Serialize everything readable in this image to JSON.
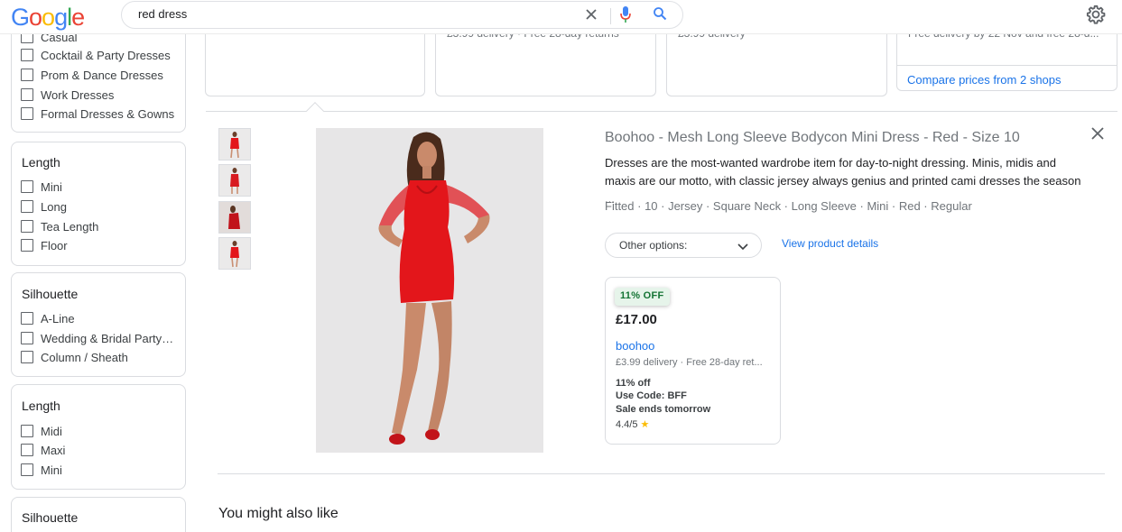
{
  "header": {
    "logo": [
      "G",
      "o",
      "o",
      "g",
      "l",
      "e"
    ],
    "logo_colors": [
      "#4285f4",
      "#ea4335",
      "#fbbc05",
      "#4285f4",
      "#34a853",
      "#ea4335"
    ],
    "search_value": "red dress",
    "icons": [
      "close-icon",
      "microphone-icon",
      "search-icon",
      "gear-icon"
    ]
  },
  "filters": [
    {
      "title": "",
      "options": [
        "Casual",
        "Cocktail & Party Dresses",
        "Prom & Dance Dresses",
        "Work Dresses",
        "Formal Dresses & Gowns"
      ]
    },
    {
      "title": "Length",
      "options": [
        "Mini",
        "Long",
        "Tea Length",
        "Floor"
      ]
    },
    {
      "title": "Silhouette",
      "options": [
        "A-Line",
        "Wedding & Bridal Party Dresses",
        "Column / Sheath"
      ]
    },
    {
      "title": "Length",
      "options": [
        "Midi",
        "Maxi",
        "Mini"
      ]
    },
    {
      "title": "Silhouette",
      "options": []
    }
  ],
  "top_cards": [
    {
      "text": "· · · · · · · · · · · · ·"
    },
    {
      "text": "£3.99 delivery · Free 28-day returns"
    },
    {
      "text": "£3.99 delivery"
    },
    {
      "text": "Free delivery by 22 Nov and free 28-d...",
      "compare": "Compare prices from 2 shops"
    }
  ],
  "product": {
    "title": "Boohoo - Mesh Long Sleeve Bodycon Mini Dress - Red - Size 10",
    "description": "Dresses are the most-wanted wardrobe item for day-to-night dressing. Minis, midis and maxis are our motto, with classic jersey always genius and printed cami dresses the season ...",
    "tags": "Fitted · 10 · Jersey · Square Neck · Long Sleeve · Mini · Red · Regular",
    "other_options": "Other options:",
    "view_details": "View product details",
    "offer": {
      "badge": "11% OFF",
      "price": "£17.00",
      "store": "boohoo",
      "delivery": "£3.99 delivery · Free 28-day ret...",
      "promo_1": "11% off",
      "promo_2": "Use Code: BFF",
      "promo_3": "Sale ends tomorrow",
      "rating": "4.4/5",
      "star": "★"
    }
  },
  "section_title": "You might also like",
  "colors": {
    "accent_link": "#1a73e8",
    "dress_red": "#e3161b",
    "badge_green": "#137333"
  }
}
